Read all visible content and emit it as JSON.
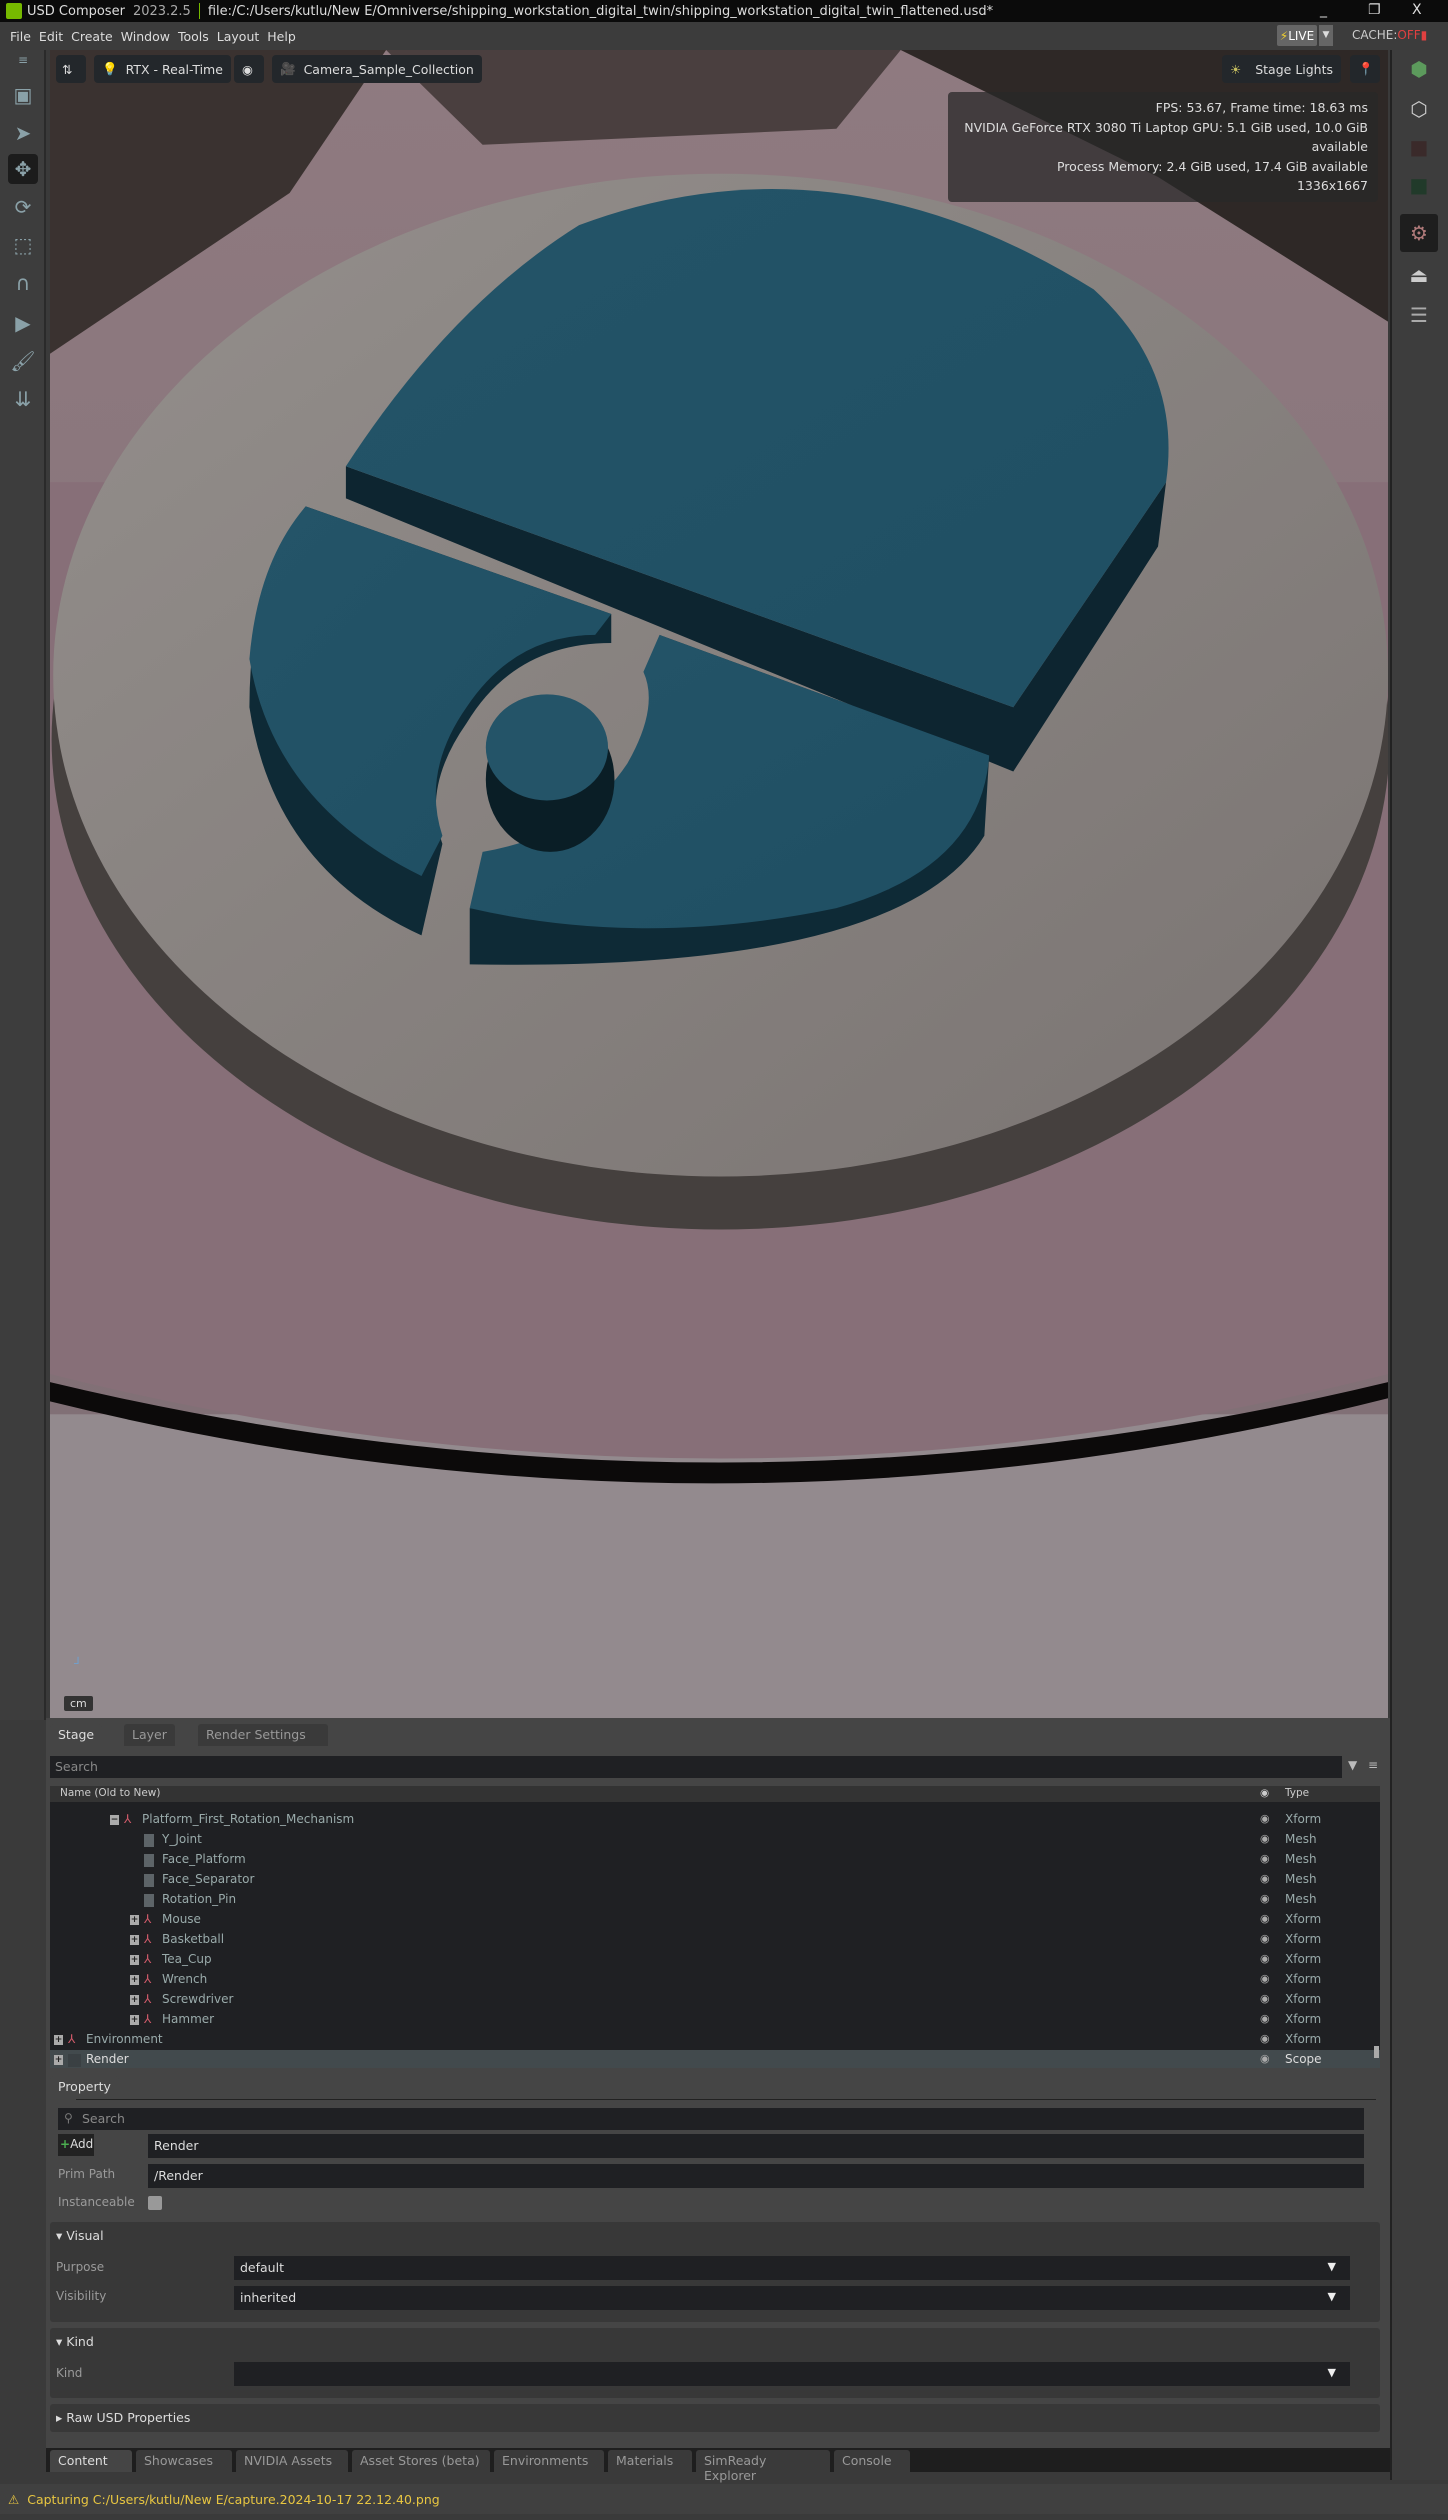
{
  "titlebar": {
    "app": "USD Composer",
    "version": "2023.2.5",
    "file": "file:/C:/Users/kutlu/New E/Omniverse/shipping_workstation_digital_twin/shipping_workstation_digital_twin_flattened.usd*",
    "minimize": "_",
    "maximize": "❐",
    "close": "X"
  },
  "menu": {
    "items": [
      "File",
      "Edit",
      "Create",
      "Window",
      "Tools",
      "Layout",
      "Help"
    ],
    "live": "LIVE",
    "cache_label": "CACHE:",
    "cache_state": "OFF"
  },
  "viewport": {
    "renderer": "RTX - Real-Time",
    "camera": "Camera_Sample_Collection",
    "lights": "Stage Lights",
    "stats": [
      "FPS: 53.67, Frame time: 18.63 ms",
      "NVIDIA GeForce RTX 3080 Ti Laptop GPU: 5.1 GiB used, 10.0 GiB available",
      "Process Memory: 2.4 GiB used, 17.4 GiB available",
      "1336x1667"
    ],
    "units": "cm",
    "colors": {
      "part_blue": "#24566a",
      "disc_grey": "#8a8582",
      "floor_pink": "#8a7378"
    }
  },
  "stage": {
    "tabs": [
      "Stage",
      "Layer",
      "Render Settings"
    ],
    "search_placeholder": "Search",
    "col_name": "Name (Old to New)",
    "col_type": "Type",
    "rows": [
      {
        "name": "Platform_First_Rotation_Mechanism",
        "type": "Xform",
        "depth": 2,
        "expander": "minus",
        "icon": "xform"
      },
      {
        "name": "Y_Joint",
        "type": "Mesh",
        "depth": 3,
        "icon": "mesh"
      },
      {
        "name": "Face_Platform",
        "type": "Mesh",
        "depth": 3,
        "icon": "mesh"
      },
      {
        "name": "Face_Separator",
        "type": "Mesh",
        "depth": 3,
        "icon": "mesh"
      },
      {
        "name": "Rotation_Pin",
        "type": "Mesh",
        "depth": 3,
        "icon": "mesh"
      },
      {
        "name": "Mouse",
        "type": "Xform",
        "depth": 3,
        "expander": "plus",
        "icon": "xform"
      },
      {
        "name": "Basketball",
        "type": "Xform",
        "depth": 3,
        "expander": "plus",
        "icon": "xform"
      },
      {
        "name": "Tea_Cup",
        "type": "Xform",
        "depth": 3,
        "expander": "plus",
        "icon": "xform"
      },
      {
        "name": "Wrench",
        "type": "Xform",
        "depth": 3,
        "expander": "plus",
        "icon": "xform"
      },
      {
        "name": "Screwdriver",
        "type": "Xform",
        "depth": 3,
        "expander": "plus",
        "icon": "xform"
      },
      {
        "name": "Hammer",
        "type": "Xform",
        "depth": 3,
        "expander": "plus",
        "icon": "xform"
      },
      {
        "name": "Environment",
        "type": "Xform",
        "depth": 0,
        "expander": "plus",
        "icon": "xform"
      },
      {
        "name": "Render",
        "type": "Scope",
        "depth": 0,
        "expander": "plus",
        "icon": "scope",
        "selected": true
      }
    ]
  },
  "property": {
    "tab": "Property",
    "search_placeholder": "Search",
    "add_label": "Add",
    "prim_name": "Render",
    "prim_path_label": "Prim Path",
    "prim_path": "/Render",
    "instanceable_label": "Instanceable",
    "instanceable": false,
    "visual": {
      "header": "Visual",
      "purpose_label": "Purpose",
      "purpose": "default",
      "visibility_label": "Visibility",
      "visibility": "inherited"
    },
    "kind": {
      "header": "Kind",
      "kind_label": "Kind",
      "kind": ""
    },
    "raw_header": "Raw USD Properties"
  },
  "bottom_tabs": [
    "Content",
    "Showcases",
    "NVIDIA Assets",
    "Asset Stores (beta)",
    "Environments",
    "Materials",
    "SimReady Explorer",
    "Console"
  ],
  "status": "Capturing C:/Users/kutlu/New E/capture.2024-10-17 22.12.40.png"
}
